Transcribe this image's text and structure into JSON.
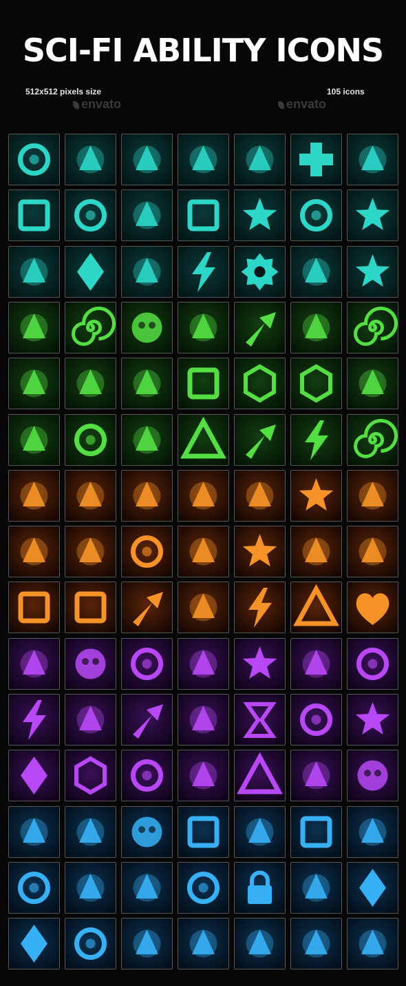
{
  "header": {
    "title": "SCI-FI ABILITY ICONS",
    "size_label": "512x512  pixels size",
    "count_label": "105 icons",
    "watermark": "envato"
  },
  "palette": {
    "teal": "#2fe0d0",
    "green": "#58e848",
    "orange": "#ff9a2a",
    "purple": "#c04cff",
    "blue": "#3ab8ff"
  },
  "rows": [
    {
      "theme": "teal",
      "icons": [
        "segmented-ring",
        "energy-comet",
        "energy-capsule",
        "winged-emblem",
        "armored-fist",
        "medical-cross",
        "monster-mouth"
      ]
    },
    {
      "theme": "teal",
      "icons": [
        "supply-crate",
        "target-lens",
        "green-fire",
        "power-card",
        "crystal-star-emblem",
        "radar-target",
        "star"
      ]
    },
    {
      "theme": "teal",
      "icons": [
        "plasma-hammer",
        "winged-crystal",
        "battle-flag",
        "lightning-strike",
        "gear",
        "wrench",
        "snowflake"
      ]
    },
    {
      "theme": "green",
      "icons": [
        "circuit-map",
        "vortex",
        "skull",
        "plasma-blast",
        "up-arrow",
        "radiation",
        "swirl"
      ]
    },
    {
      "theme": "green",
      "icons": [
        "energy-blade",
        "syringe",
        "flask",
        "square-frame",
        "cell-membrane",
        "honeycomb",
        "claw"
      ]
    },
    {
      "theme": "green",
      "icons": [
        "robot-arm",
        "reactor-core",
        "acid-splash",
        "triangle-spiral",
        "growth-chart",
        "toxic-lightning",
        "spiral-emblem"
      ]
    },
    {
      "theme": "orange",
      "icons": [
        "flamethrower",
        "meteor-impact",
        "missiles",
        "laser-gun",
        "bullet",
        "nuclear-explosion",
        "drone"
      ]
    },
    {
      "theme": "orange",
      "icons": [
        "fire-cannon",
        "mech-face",
        "crosshair",
        "red-eye",
        "explosion",
        "fire-rain",
        "fire"
      ]
    },
    {
      "theme": "orange",
      "icons": [
        "battery",
        "armor-plate",
        "rank-insignia",
        "blaster",
        "lightning-bolt",
        "warning-sign",
        "heart"
      ]
    },
    {
      "theme": "purple",
      "icons": [
        "alien-eye",
        "planet",
        "black-hole",
        "tentacle",
        "spark",
        "laser-beam",
        "eye"
      ]
    },
    {
      "theme": "purple",
      "icons": [
        "energy-web",
        "cracked-orb",
        "chevrons",
        "rocket-engine",
        "hourglass",
        "eyeball",
        "light-burst"
      ]
    },
    {
      "theme": "purple",
      "icons": [
        "crystal-shard",
        "hex-shield",
        "dark-orb",
        "energy-slash",
        "triangle-rune",
        "comet",
        "cyber-skull"
      ]
    },
    {
      "theme": "blue",
      "icons": [
        "circuit",
        "rock-armor",
        "planet-shield",
        "ice-block",
        "hologram-soldier",
        "cube-frame",
        "dark-egg"
      ]
    },
    {
      "theme": "blue",
      "icons": [
        "target-arrow",
        "armored-bus",
        "power-cell",
        "heart-shield",
        "padlock",
        "ice-streak",
        "stone"
      ]
    },
    {
      "theme": "blue",
      "icons": [
        "diamond-frame",
        "robot-eye",
        "ice-comet",
        "dog-tags",
        "ice-shards",
        "bullets",
        "grenade"
      ]
    }
  ]
}
